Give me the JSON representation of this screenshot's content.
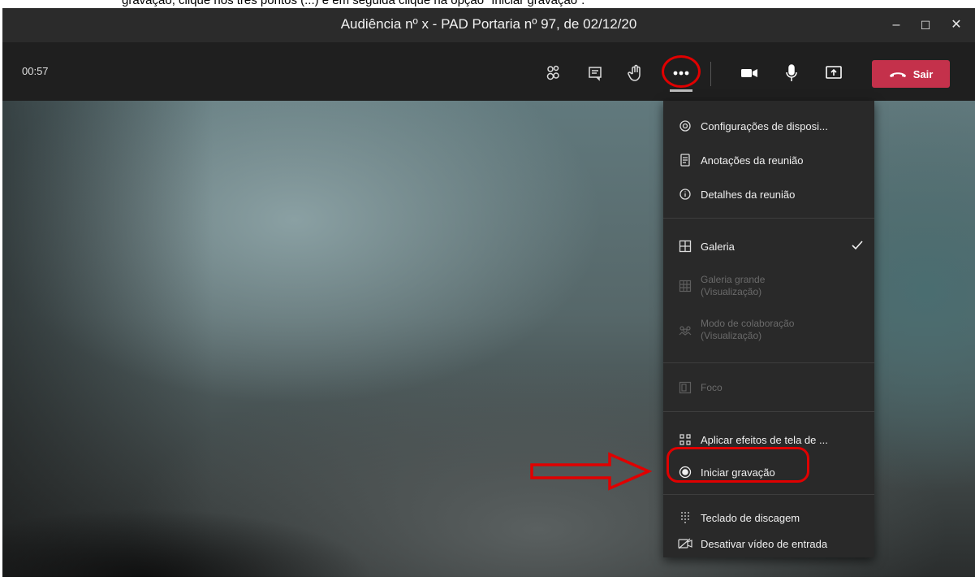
{
  "doc_text": "fig_text_fragment",
  "window": {
    "title": "Audiência nº x - PAD Portaria nº 97, de 02/12/20",
    "controls": {
      "minimize": "–",
      "maximize": "☐",
      "close": "✕"
    }
  },
  "toolbar": {
    "timer": "00:57",
    "buttons": [
      {
        "name": "participants-icon"
      },
      {
        "name": "chat-icon"
      },
      {
        "name": "raise-hand-icon"
      },
      {
        "name": "more-actions-icon"
      },
      {
        "name": "camera-icon"
      },
      {
        "name": "microphone-icon"
      },
      {
        "name": "share-screen-icon"
      }
    ],
    "leave_label": "Sair"
  },
  "menu": {
    "items": [
      {
        "label": "Configurações de disposi...",
        "icon": "gear-icon",
        "disabled": false
      },
      {
        "label": "Anotações da reunião",
        "icon": "notes-icon",
        "disabled": false
      },
      {
        "label": "Detalhes da reunião",
        "icon": "info-icon",
        "disabled": false
      },
      {
        "label": "Galeria",
        "icon": "gallery-icon",
        "disabled": false,
        "checked": true
      },
      {
        "label_line1": "Galeria grande",
        "label_line2": "(Visualização)",
        "icon": "large-gallery-icon",
        "disabled": true
      },
      {
        "label_line1": "Modo de colaboração",
        "label_line2": "(Visualização)",
        "icon": "together-mode-icon",
        "disabled": true
      },
      {
        "label": "Foco",
        "icon": "focus-icon",
        "disabled": true
      },
      {
        "label": "Aplicar efeitos de tela de ...",
        "icon": "background-effects-icon",
        "disabled": false
      },
      {
        "label": "Iniciar gravação",
        "icon": "record-icon",
        "disabled": false
      },
      {
        "label": "Teclado de discagem",
        "icon": "dial-pad-icon",
        "disabled": false
      },
      {
        "label": "Desativar vídeo de entrada",
        "icon": "video-off-icon",
        "disabled": false
      }
    ]
  },
  "colors": {
    "leave": "#c4314b",
    "annotation": "#e00000",
    "menu_bg": "#292929"
  }
}
